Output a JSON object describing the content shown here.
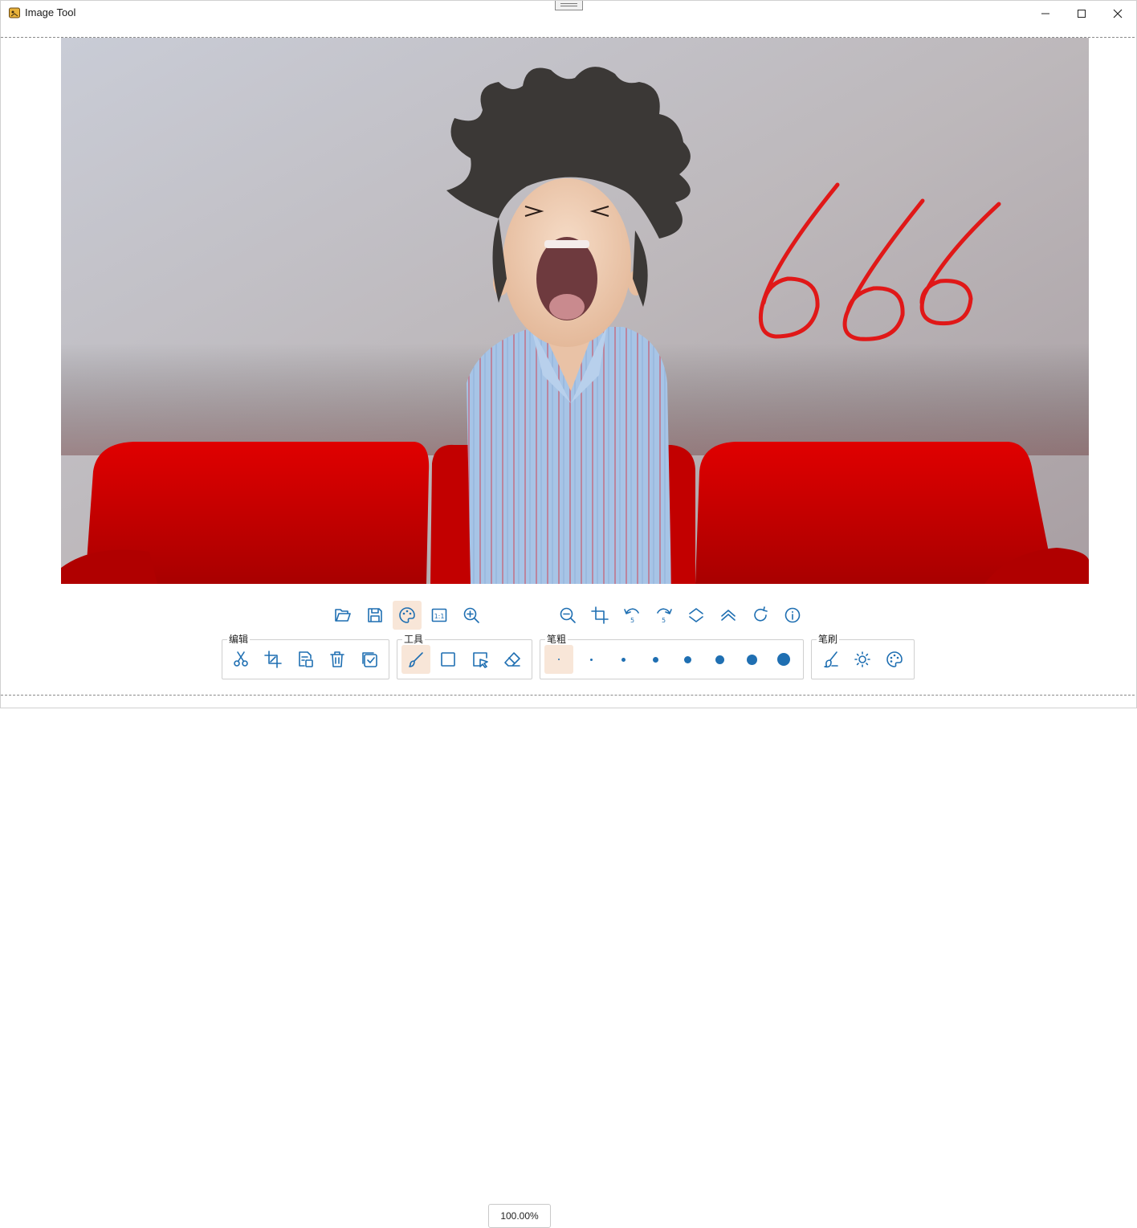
{
  "window": {
    "title": "Image Tool"
  },
  "image": {
    "annotation_text": "666"
  },
  "toolbar": {
    "zoom_value": "100.00%",
    "icons": [
      "folder-open-icon",
      "save-icon",
      "palette-icon",
      "actual-size-icon",
      "zoom-in-icon",
      "zoom-out-icon",
      "crop-icon",
      "rotate-left-icon",
      "rotate-right-icon",
      "flip-vertical-icon",
      "flip-horizontal-icon",
      "refresh-icon",
      "info-icon"
    ]
  },
  "groups": {
    "edit": {
      "label": "编辑",
      "icons": [
        "cut-icon",
        "crop-icon",
        "copy-icon",
        "delete-icon",
        "confirm-icon"
      ]
    },
    "tools": {
      "label": "工具",
      "icons": [
        "brush-icon",
        "rectangle-icon",
        "select-icon",
        "eraser-icon"
      ]
    },
    "stroke": {
      "label": "笔粗",
      "sizes": [
        2,
        3,
        5,
        7,
        9,
        11,
        13,
        15
      ]
    },
    "brush": {
      "label": "笔刷",
      "icons": [
        "brush-style-icon",
        "brightness-icon",
        "color-palette-icon"
      ]
    }
  },
  "colors": {
    "accent": "#1f6fb2",
    "active_bg": "#f8e6d8",
    "annotation": "#e01818"
  }
}
